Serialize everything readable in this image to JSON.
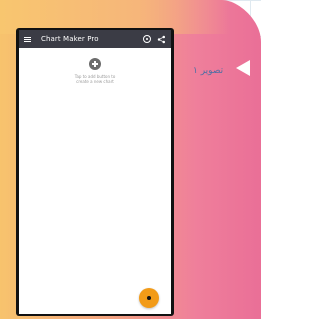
{
  "app_bar": {
    "title": "Chart Maker Pro",
    "menu_icon": "menu-icon",
    "settings_icon": "settings-icon",
    "share_icon": "share-icon"
  },
  "empty_state": {
    "icon": "add-circle-icon",
    "text_line_1": "Tap to add button to",
    "text_line_2": "create a new chart"
  },
  "fab": {
    "icon": "add-icon"
  },
  "caption": {
    "text": "تصویر ۱"
  },
  "colors": {
    "app_bar": "#3b3c45",
    "fab": "#f29b18",
    "accent_start": "#f7c36d",
    "accent_end": "#ea6f97",
    "caption": "#4f6fa4"
  }
}
